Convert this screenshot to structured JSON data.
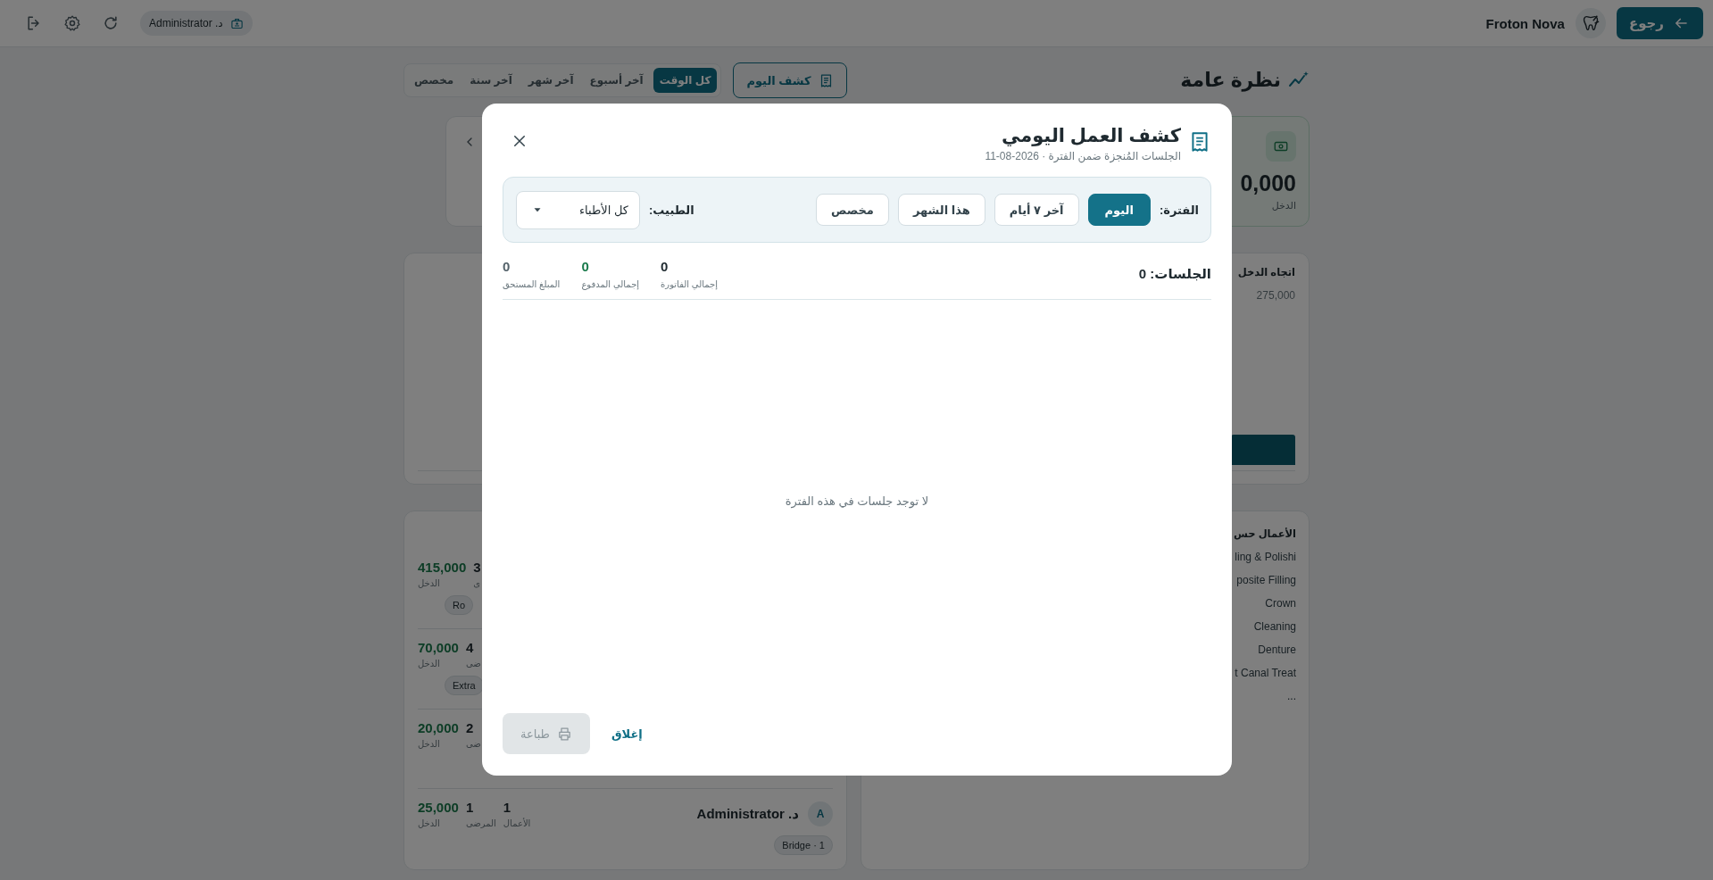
{
  "top_bar": {
    "back_button": "رجوع",
    "app_name": "Froton Nova",
    "user_chip": "د. Administrator"
  },
  "overview": {
    "title": "نظرة عامة",
    "report_button": "كشف اليوم",
    "ranges": [
      {
        "label": "كل الوقت",
        "selected": true
      },
      {
        "label": "آخر أسبوع",
        "selected": false
      },
      {
        "label": "آخر شهر",
        "selected": false
      },
      {
        "label": "آخر سنة",
        "selected": false
      },
      {
        "label": "مخصص",
        "selected": false
      }
    ]
  },
  "income_card": {
    "value": "0,000",
    "label": "الدخل"
  },
  "trend_card": {
    "title": "اتجاه الدخل",
    "y_tick": "275,000"
  },
  "doctors_card": {
    "rows": [
      {
        "income": "415,000",
        "income_label": "الدخل",
        "patients": "3",
        "patients_label": "ى",
        "chips": [
          "Ro"
        ]
      },
      {
        "income": "70,000",
        "income_label": "الدخل",
        "patients": "4",
        "patients_label": "ضى",
        "chips": [
          "Extra"
        ]
      },
      {
        "income": "20,000",
        "income_label": "الدخل",
        "patients": "2",
        "patients_label": "ضى"
      },
      {
        "income": "25,000",
        "income_label": "الدخل",
        "patients": "1",
        "patients_label": "المرضى",
        "works": "1",
        "works_label": "الأعمال",
        "name": "د. Administrator",
        "avatar": "A",
        "chips": [
          "Bridge · 1"
        ]
      }
    ]
  },
  "treatments_card": {
    "title": "الأعمال حس",
    "items": [
      "ling & Polishi",
      "posite Filling",
      "Crown",
      "Cleaning",
      "Denture",
      "t Canal Treat",
      "..."
    ]
  },
  "modal": {
    "title": "كشف العمل اليومي",
    "subtitle": "الجلسات المُنجزة ضمن الفترة · 2026-08-11",
    "period_label": "الفترة:",
    "periods": [
      {
        "label": "اليوم",
        "selected": true
      },
      {
        "label": "آخر ٧ أيام",
        "selected": false
      },
      {
        "label": "هذا الشهر",
        "selected": false
      },
      {
        "label": "مخصص",
        "selected": false
      }
    ],
    "doctor_label": "الطبيب:",
    "doctor_value": "كل الأطباء",
    "sessions": "الجلسات: 0",
    "stats": [
      {
        "value": "0",
        "label": "إجمالي الفاتورة",
        "color": "#1f2a30"
      },
      {
        "value": "0",
        "label": "إجمالي المدفوع",
        "color": "#1a7a4c"
      },
      {
        "value": "0",
        "label": "المبلغ المستحق",
        "color": "#55636b"
      }
    ],
    "empty_message": "لا توجد جلسات في هذه الفترة",
    "close_link": "إغلاق",
    "print_button": {
      "label": "طباعة",
      "disabled": true
    }
  }
}
